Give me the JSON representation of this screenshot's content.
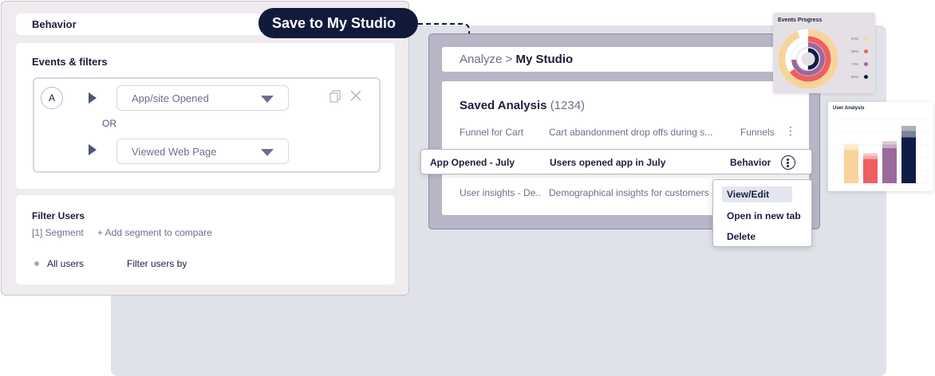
{
  "behavior_panel": {
    "header": "Behavior",
    "events": {
      "title": "Events & filters",
      "badge": "A",
      "event_1": "App/site Opened",
      "connector": "OR",
      "event_2": "Viewed Web Page"
    },
    "filter_users": {
      "title": "Filter Users",
      "segment": "[1] Segment",
      "add_segment": "+ Add segment to compare",
      "all_users": "All users",
      "filter_by": "Filter users by"
    }
  },
  "callout": {
    "label": "Save to My Studio"
  },
  "studio": {
    "breadcrumb_parent": "Analyze",
    "breadcrumb_sep": " > ",
    "breadcrumb_current": "My Studio",
    "saved_title": "Saved Analysis",
    "saved_count": "(1234)",
    "rows": [
      {
        "name": "Funnel for Cart",
        "description": "Cart abandonment drop offs during s...",
        "type": "Funnels"
      },
      {
        "name": "App Opened - July",
        "description": "Users opened app in July",
        "type": "Behavior"
      },
      {
        "name": "User insights - De..",
        "description": "Demographical insights for customers",
        "type": ""
      }
    ],
    "menu": [
      "View/Edit",
      "Open in new tab",
      "Delete"
    ]
  },
  "events_progress": {
    "title": "Events Progress",
    "items": [
      {
        "label": "94%",
        "value": 94,
        "color": "#f7d49a"
      },
      {
        "label": "65%",
        "value": 65,
        "color": "#ef5f5f"
      },
      {
        "label": "74%",
        "value": 74,
        "color": "#9a6a9c"
      },
      {
        "label": "50%",
        "value": 50,
        "color": "#0f1c45"
      }
    ]
  },
  "user_analysis": {
    "title": "User Analysis",
    "colors": [
      "#f7d49a",
      "#ef5f5f",
      "#9a6a9c",
      "#0f1c45"
    ],
    "bars": [
      [
        0.52,
        0.06,
        0.04
      ],
      [
        0.38,
        0.05,
        0.04
      ],
      [
        0.55,
        0.06,
        0.05
      ],
      [
        0.72,
        0.1,
        0.08
      ]
    ]
  }
}
